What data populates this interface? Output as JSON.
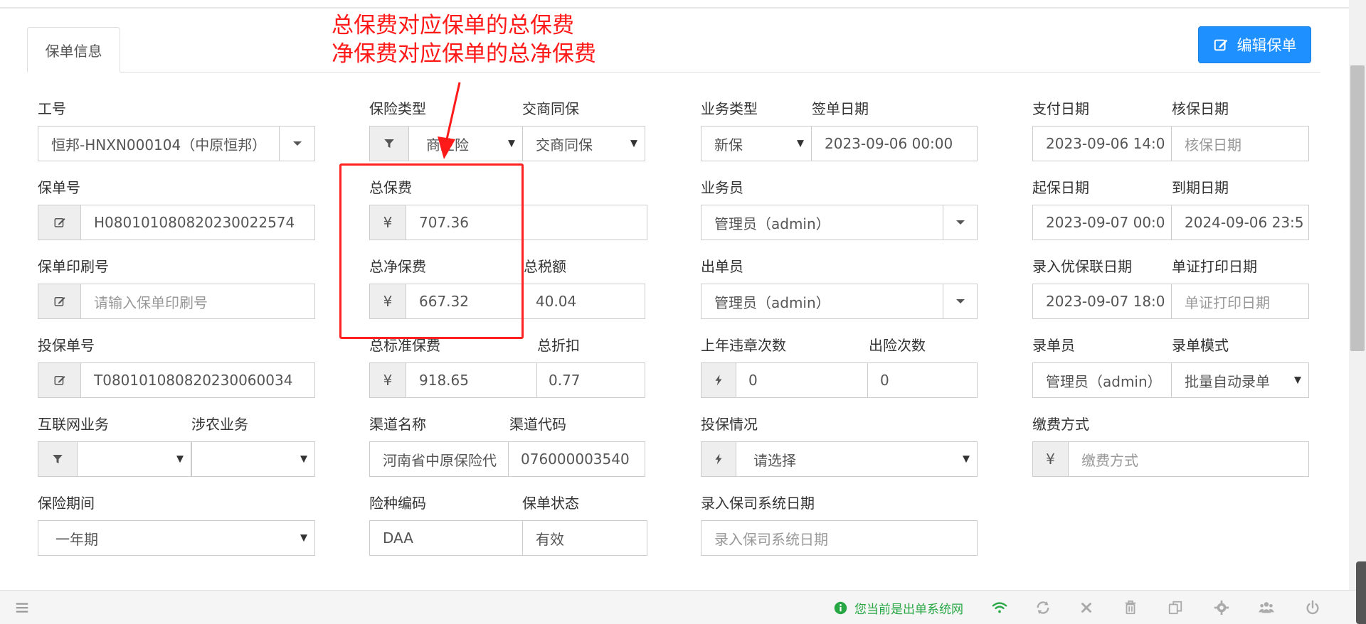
{
  "tab": {
    "label": "保单信息"
  },
  "annotation": {
    "line1": "总保费对应保单的总保费",
    "line2": "净保费对应保单的总净保费"
  },
  "edit_button": {
    "label": "编辑保单"
  },
  "form": {
    "employee_id": {
      "label": "工号",
      "value": "恒邦-HNXN000104（中原恒邦）"
    },
    "policy_no": {
      "label": "保单号",
      "value": "H080101080820230022574"
    },
    "print_no": {
      "label": "保单印刷号",
      "placeholder": "请输入保单印刷号"
    },
    "proposal_no": {
      "label": "投保单号",
      "value": "T080101080820230060034"
    },
    "internet_business": {
      "label": "互联网业务",
      "value": ""
    },
    "agri_business": {
      "label": "涉农业务",
      "value": ""
    },
    "insurance_period": {
      "label": "保险期间",
      "value": "一年期"
    },
    "insurance_type": {
      "label": "保险类型",
      "value": "商业险"
    },
    "joint_insure": {
      "label": "交商同保",
      "value": "交商同保"
    },
    "total_premium": {
      "label": "总保费",
      "currency": "¥",
      "value": "707.36"
    },
    "net_premium": {
      "label": "总净保费",
      "currency": "¥",
      "value": "667.32"
    },
    "total_tax": {
      "label": "总税额",
      "value": "40.04"
    },
    "standard_premium": {
      "label": "总标准保费",
      "currency": "¥",
      "value": "918.65"
    },
    "discount": {
      "label": "总折扣",
      "value": "0.77"
    },
    "channel_name": {
      "label": "渠道名称",
      "value": "河南省中原保险代"
    },
    "channel_code": {
      "label": "渠道代码",
      "value": "076000003540"
    },
    "product_code": {
      "label": "险种编码",
      "value": "DAA"
    },
    "policy_status": {
      "label": "保单状态",
      "value": "有效"
    },
    "business_type": {
      "label": "业务类型",
      "value": "新保"
    },
    "sign_date": {
      "label": "签单日期",
      "value": "2023-09-06 00:00"
    },
    "salesman": {
      "label": "业务员",
      "value": "管理员（admin）"
    },
    "issuer": {
      "label": "出单员",
      "value": "管理员（admin）"
    },
    "violations": {
      "label": "上年违章次数",
      "value": "0"
    },
    "claims": {
      "label": "出险次数",
      "value": "0"
    },
    "insure_status": {
      "label": "投保情况",
      "value": "请选择"
    },
    "enter_insurer_date": {
      "label": "录入保司系统日期",
      "placeholder": "录入保司系统日期"
    },
    "pay_date": {
      "label": "支付日期",
      "value": "2023-09-06 14:0"
    },
    "underwrite_date": {
      "label": "核保日期",
      "placeholder": "核保日期"
    },
    "start_date": {
      "label": "起保日期",
      "value": "2023-09-07 00:0"
    },
    "end_date": {
      "label": "到期日期",
      "value": "2024-09-06 23:5"
    },
    "ubl_date": {
      "label": "录入优保联日期",
      "value": "2023-09-07 18:0"
    },
    "print_date": {
      "label": "单证打印日期",
      "placeholder": "单证打印日期"
    },
    "entry_clerk": {
      "label": "录单员",
      "value": "管理员（admin）"
    },
    "entry_mode": {
      "label": "录单模式",
      "value": "批量自动录单"
    },
    "pay_method": {
      "label": "缴费方式",
      "currency": "¥",
      "placeholder": "缴费方式"
    }
  },
  "footer": {
    "status_text": "您当前是出单系统网"
  },
  "colors": {
    "accent": "#1e90ff",
    "annotation": "#ff1a1a",
    "status_ok": "#28a745"
  }
}
